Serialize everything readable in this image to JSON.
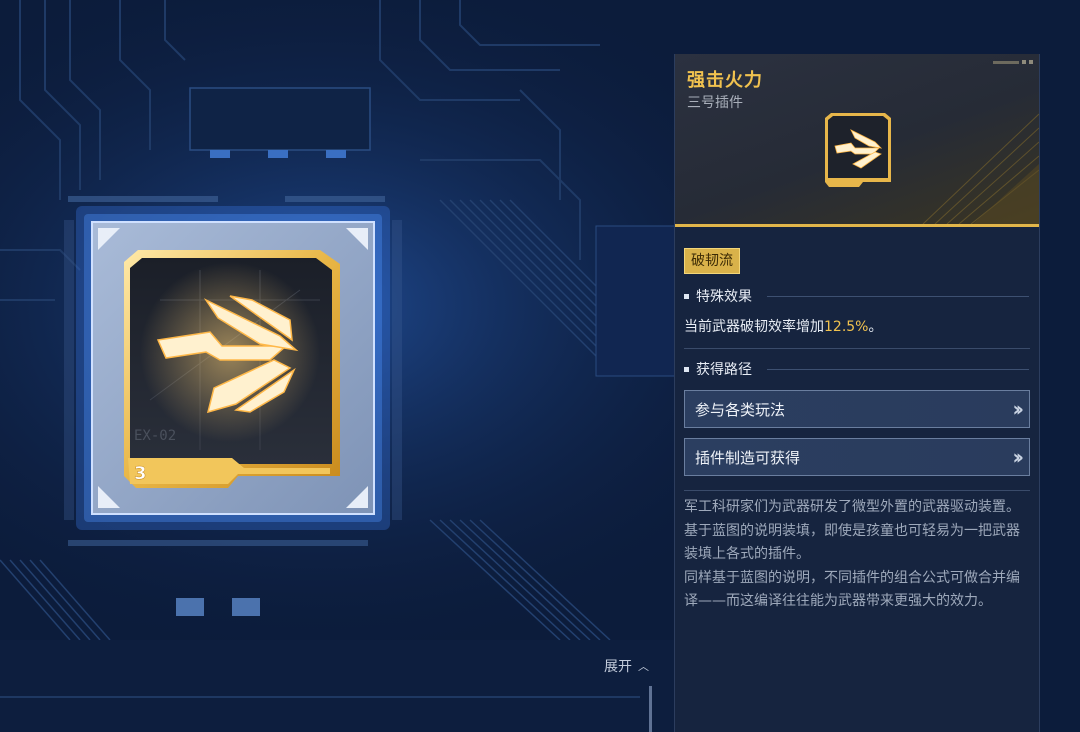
{
  "item": {
    "title": "强击火力",
    "subtitle": "三号插件",
    "card_code": "EX-02",
    "card_level": "3"
  },
  "tag": "破韧流",
  "effect_section": {
    "title": "特殊效果",
    "text_prefix": "当前武器破韧效率增加",
    "value": "12.5%",
    "text_suffix": "。"
  },
  "routes_section": {
    "title": "获得路径",
    "routes": [
      {
        "label": "参与各类玩法"
      },
      {
        "label": "插件制造可获得"
      }
    ]
  },
  "description": [
    "军工科研家们为武器研发了微型外置的武器驱动装置。",
    "基于蓝图的说明装填，即使是孩童也可轻易为一把武器装填上各式的插件。",
    "同样基于蓝图的说明，不同插件的组合公式可做合并编译——而这编译往往能为武器带来更强大的效力。"
  ],
  "footer": {
    "expand_label": "展开"
  },
  "colors": {
    "accent_gold": "#f1c24f",
    "background": "#0b1a38",
    "panel": "#16243f"
  }
}
